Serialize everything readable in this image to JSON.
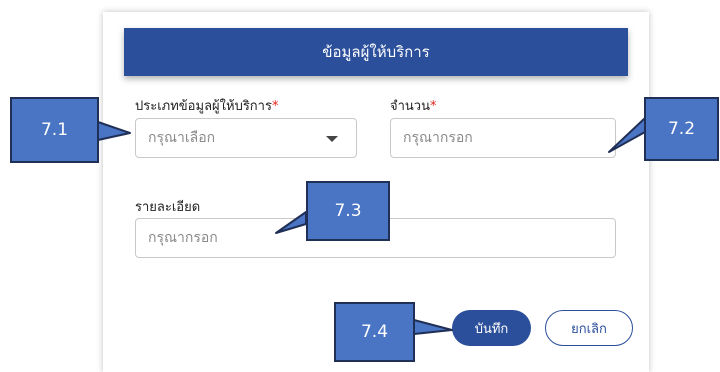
{
  "dialog": {
    "title": "ข้อมูลผู้ให้บริการ",
    "type_field": {
      "label": "ประเภทข้อมูลผู้ให้บริการ",
      "required_mark": "*",
      "placeholder": "กรุณาเลือก"
    },
    "amount_field": {
      "label": "จำนวน",
      "required_mark": "*",
      "placeholder": "กรุณากรอก"
    },
    "detail_field": {
      "label": "รายละเอียด",
      "placeholder": "กรุณากรอก"
    },
    "save_label": "บันทึก",
    "cancel_label": "ยกเลิก"
  },
  "callouts": {
    "c1": "7.1",
    "c2": "7.2",
    "c3": "7.3",
    "c4": "7.4"
  },
  "colors": {
    "primary": "#2b4f9b",
    "callout": "#4a74c4",
    "required": "#e0261c"
  }
}
